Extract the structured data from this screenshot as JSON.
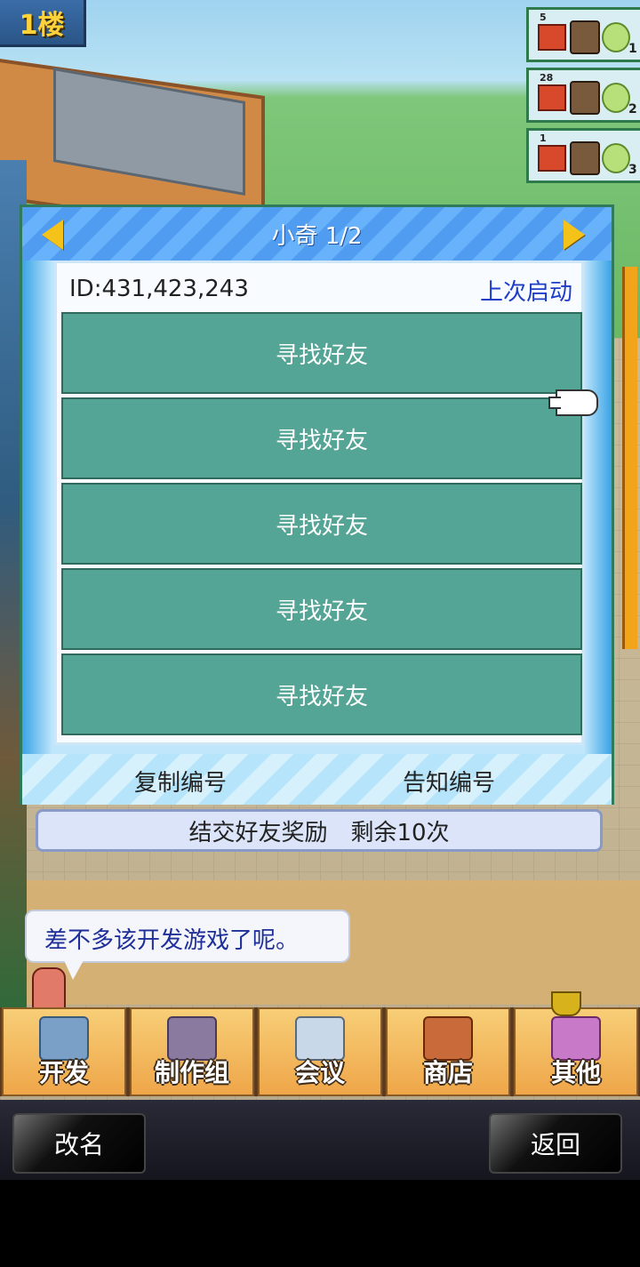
{
  "floor": {
    "label": "1楼"
  },
  "queue": [
    {
      "count": "5",
      "index": "1"
    },
    {
      "count": "28",
      "index": "2"
    },
    {
      "count": "1",
      "index": "3"
    }
  ],
  "dialog": {
    "title": "小奇 1/2",
    "id_text": "ID:431,423,243",
    "last_launch": "上次启动",
    "friends": [
      "寻找好友",
      "寻找好友",
      "寻找好友",
      "寻找好友",
      "寻找好友"
    ],
    "copy_label": "复制编号",
    "notify_label": "告知编号"
  },
  "reward_text": "结交好友奖励　剩余10次",
  "bubble_text": "差不多该开发游戏了呢。",
  "menu": [
    {
      "label": "开发",
      "icon": "monitor-icon",
      "color": "#7aa0c8"
    },
    {
      "label": "制作组",
      "icon": "team-icon",
      "color": "#8a7aa0"
    },
    {
      "label": "会议",
      "icon": "chat-icon",
      "color": "#c8d8e8"
    },
    {
      "label": "商店",
      "icon": "treasure-chest-icon",
      "color": "#c86a3a"
    },
    {
      "label": "其他",
      "icon": "music-note-icon",
      "color": "#c87ac8"
    }
  ],
  "buttons": {
    "rename": "改名",
    "back": "返回"
  }
}
